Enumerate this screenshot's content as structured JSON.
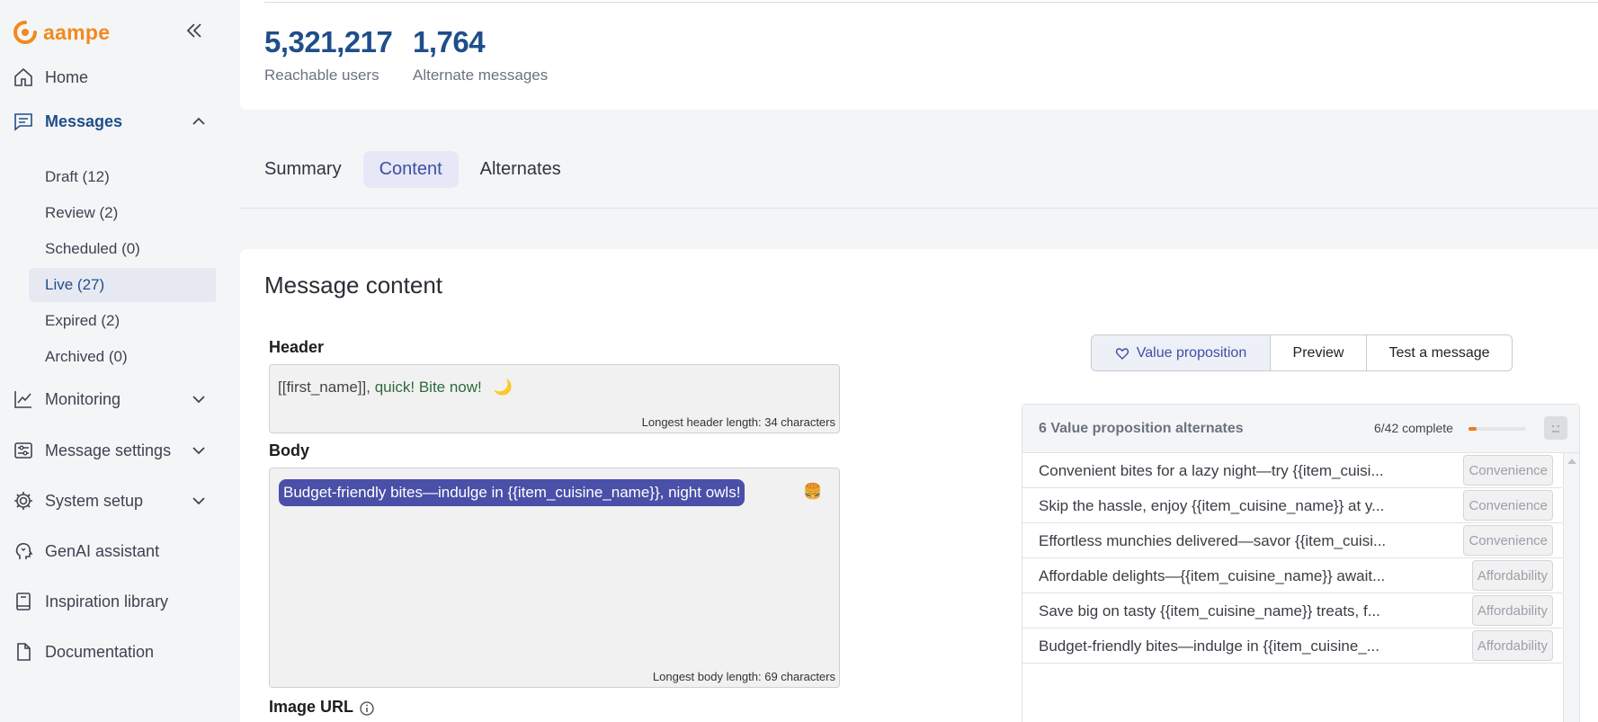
{
  "brand": {
    "name": "aampe",
    "color": "#f08a1c"
  },
  "sidebar": {
    "nav": [
      {
        "id": "home",
        "label": "Home",
        "icon": "home-icon"
      },
      {
        "id": "messages",
        "label": "Messages",
        "icon": "message-icon",
        "expanded": true
      },
      {
        "id": "monitoring",
        "label": "Monitoring",
        "icon": "chart-line-icon"
      },
      {
        "id": "message-settings",
        "label": "Message settings",
        "icon": "sliders-icon"
      },
      {
        "id": "system-setup",
        "label": "System setup",
        "icon": "gear-icon"
      },
      {
        "id": "genai",
        "label": "GenAI assistant",
        "icon": "ai-head-icon"
      },
      {
        "id": "inspiration",
        "label": "Inspiration library",
        "icon": "book-icon"
      },
      {
        "id": "docs",
        "label": "Documentation",
        "icon": "document-icon"
      }
    ],
    "message_sub": [
      "Draft (12)",
      "Review (2)",
      "Scheduled (0)",
      "Live (27)",
      "Expired (2)",
      "Archived (0)"
    ]
  },
  "stats": [
    {
      "value": "5,321,217",
      "label": "Reachable users"
    },
    {
      "value": "1,764",
      "label": "Alternate messages"
    }
  ],
  "tabs": [
    "Summary",
    "Content",
    "Alternates"
  ],
  "content": {
    "title": "Message content",
    "header_label": "Header",
    "header_text_prefix": "[[first_name]], ",
    "header_text_green": "quick! Bite now!",
    "header_emoji": "🌙",
    "header_hint": "Longest header length: 34 characters",
    "body_label": "Body",
    "body_text": "Budget-friendly bites—indulge in {{item_cuisine_name}}, night owls!",
    "body_emoji": "🍔",
    "body_hint": "Longest body length: 69 characters",
    "image_label": "Image URL"
  },
  "segmented": [
    "Value proposition",
    "Preview",
    "Test a message"
  ],
  "vp": {
    "title": "6 Value proposition alternates",
    "progress_text": "6/42 complete",
    "progress": 0.143,
    "rows": [
      {
        "text": "Convenient bites for a lazy night—try {{item_cuisi...",
        "tag": "Convenience"
      },
      {
        "text": "Skip the hassle, enjoy {{item_cuisine_name}} at y...",
        "tag": "Convenience"
      },
      {
        "text": "Effortless munchies delivered—savor {{item_cuisi...",
        "tag": "Convenience"
      },
      {
        "text": "Affordable delights—{{item_cuisine_name}} await...",
        "tag": "Affordability"
      },
      {
        "text": "Save big on tasty {{item_cuisine_name}} treats, f...",
        "tag": "Affordability"
      },
      {
        "text": "Budget-friendly bites—indulge in {{item_cuisine_...",
        "tag": "Affordability"
      }
    ]
  }
}
